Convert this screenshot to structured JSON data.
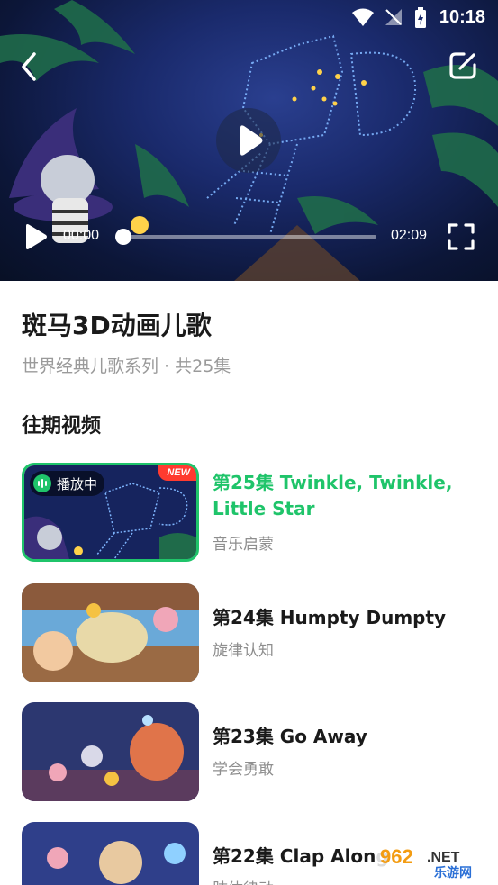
{
  "status_bar": {
    "time": "10:18",
    "icons": [
      "wifi-icon",
      "no-signal-icon",
      "battery-charging-icon"
    ]
  },
  "player": {
    "current_time": "00:00",
    "total_time": "02:09",
    "progress": 0.0,
    "icons": [
      "back-arrow-icon",
      "share-edit-icon",
      "play-icon",
      "fullscreen-icon"
    ]
  },
  "series": {
    "title": "斑马3D动画儿歌",
    "subtitle": "世界经典儿歌系列 · 共25集"
  },
  "section": {
    "title": "往期视频"
  },
  "episodes": [
    {
      "title": "第25集 Twinkle, Twinkle, Little Star",
      "desc": "音乐启蒙",
      "active": true,
      "badge_playing": "播放中",
      "badge_new": "NEW"
    },
    {
      "title": "第24集 Humpty Dumpty",
      "desc": "旋律认知",
      "active": false
    },
    {
      "title": "第23集 Go Away",
      "desc": "学会勇敢",
      "active": false
    },
    {
      "title": "第22集 Clap Along",
      "desc": "肢体律动",
      "active": false
    }
  ],
  "watermark": {
    "text_num": "962",
    "text_net": ".NET",
    "text_cn": "乐游网"
  },
  "colors": {
    "accent": "#1fc46a",
    "new_badge": "#ff3b30",
    "muted": "#9a9a9a"
  }
}
